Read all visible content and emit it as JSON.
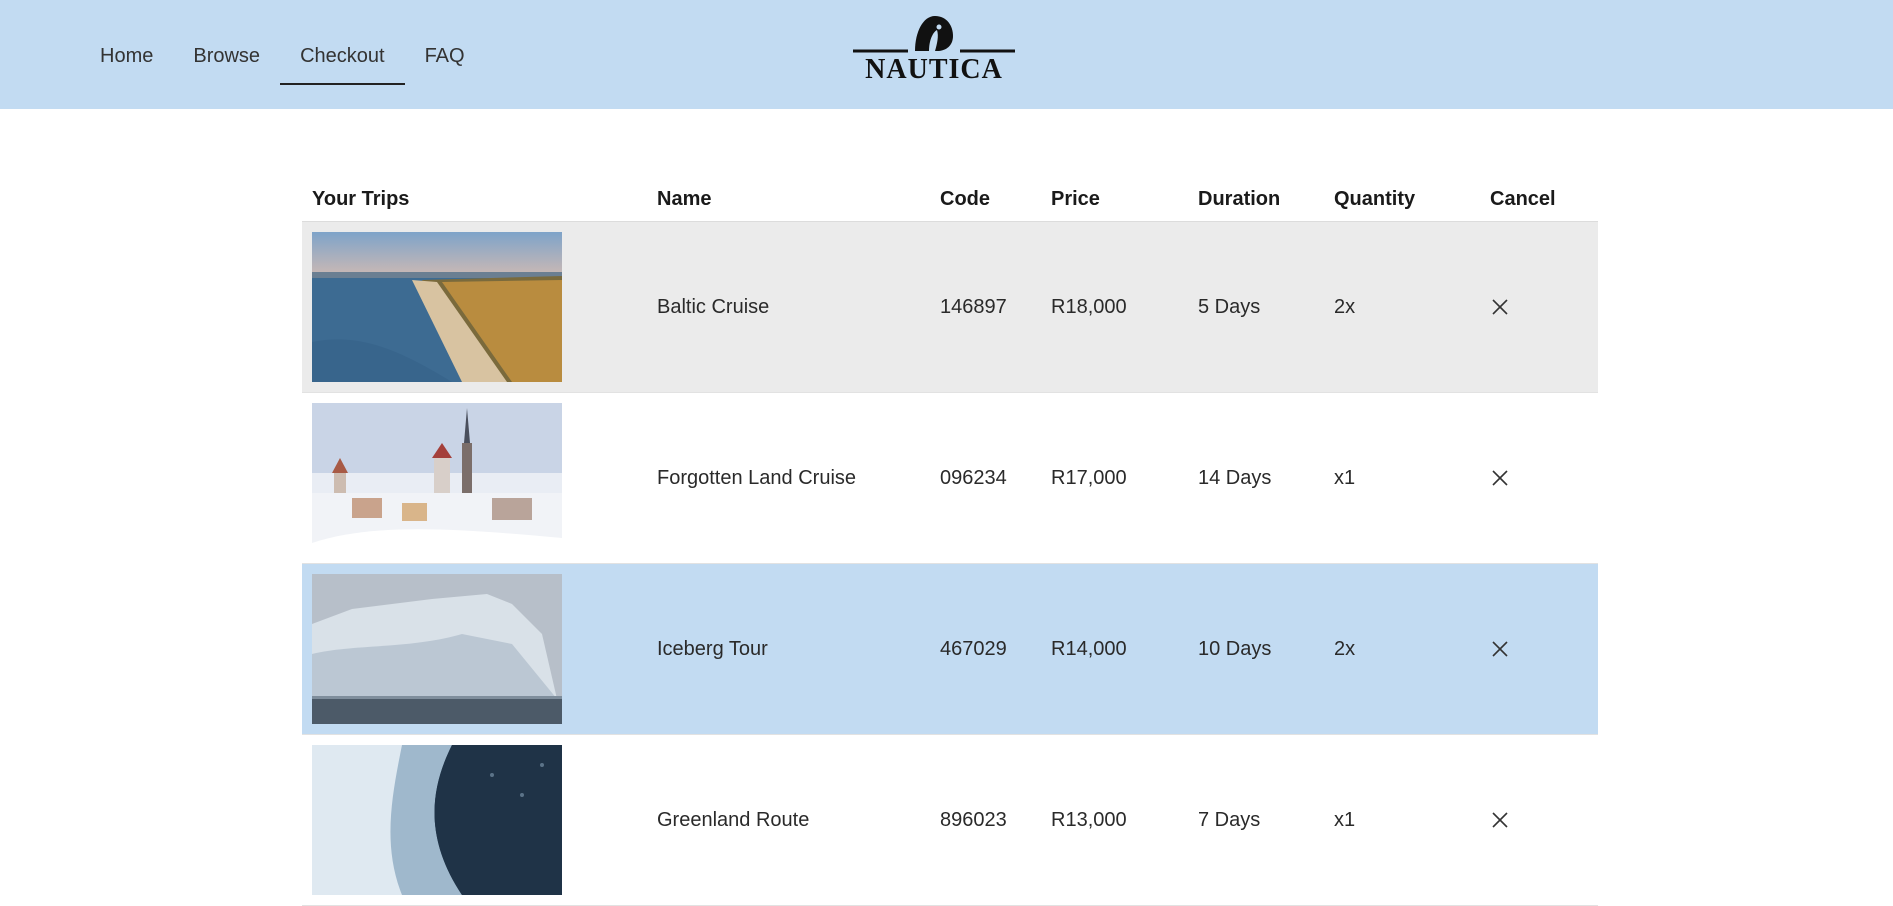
{
  "nav": {
    "items": [
      {
        "label": "Home",
        "active": false
      },
      {
        "label": "Browse",
        "active": false
      },
      {
        "label": "Checkout",
        "active": true
      },
      {
        "label": "FAQ",
        "active": false
      }
    ]
  },
  "logo": {
    "text": "NAUTICA",
    "icon": "penguin-logo-icon"
  },
  "table": {
    "headers": {
      "trips": "Your Trips",
      "name": "Name",
      "code": "Code",
      "price": "Price",
      "duration": "Duration",
      "quantity": "Quantity",
      "cancel": "Cancel"
    },
    "rows": [
      {
        "image": "coastline-aerial-photo",
        "name": "Baltic Cruise",
        "code": "146897",
        "price": "R18,000",
        "duration": "5 Days",
        "quantity": "2x",
        "cancel_icon": "close-icon",
        "highlight": "gray"
      },
      {
        "image": "snowy-old-town-photo",
        "name": "Forgotten Land Cruise",
        "code": "096234",
        "price": "R17,000",
        "duration": "14 Days",
        "quantity": "x1",
        "cancel_icon": "close-icon",
        "highlight": "white"
      },
      {
        "image": "iceberg-photo",
        "name": "Iceberg Tour",
        "code": "467029",
        "price": "R14,000",
        "duration": "10 Days",
        "quantity": "2x",
        "cancel_icon": "close-icon",
        "highlight": "blue"
      },
      {
        "image": "ship-wake-sea-photo",
        "name": "Greenland Route",
        "code": "896023",
        "price": "R13,000",
        "duration": "7 Days",
        "quantity": "x1",
        "cancel_icon": "close-icon",
        "highlight": "white"
      }
    ]
  },
  "colors": {
    "header_bg": "#c2dbf2",
    "row_gray": "#ebebeb",
    "row_blue": "#c2dbf2"
  }
}
